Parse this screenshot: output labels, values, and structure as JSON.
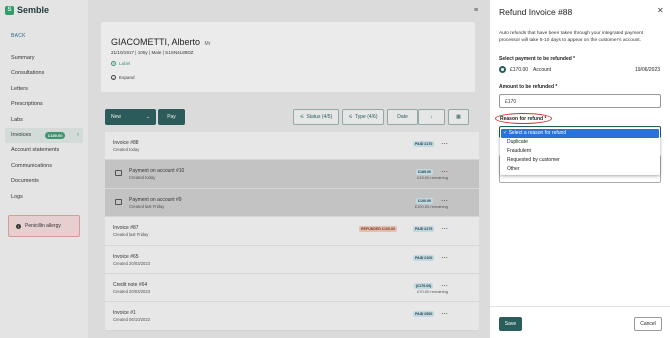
{
  "app": {
    "name": "Semble"
  },
  "sidebar": {
    "back": "BACK",
    "items": [
      {
        "label": "Summary"
      },
      {
        "label": "Consultations"
      },
      {
        "label": "Letters"
      },
      {
        "label": "Prescriptions"
      },
      {
        "label": "Labs"
      },
      {
        "label": "Invoices",
        "badge": "£189.00",
        "active": true
      },
      {
        "label": "Account statements"
      },
      {
        "label": "Communications"
      },
      {
        "label": "Documents"
      },
      {
        "label": "Logs"
      }
    ],
    "allergy": "Penicillin allergy"
  },
  "patient": {
    "name": "GIACOMETTI, Alberto",
    "title": "Mr",
    "meta": "21/10/1917  |  105y  |  Male  |  S1SN4L89DZ",
    "label_link": "Label",
    "expand": "Expand"
  },
  "toolbar": {
    "new": "New",
    "pay": "Pay",
    "status": "Status (4/5)",
    "type": "Type (4/6)",
    "date": "Date",
    "sort_icon": "arrow-down-icon",
    "view_icon": "grid-icon"
  },
  "invoices": [
    {
      "title": "Invoice #88",
      "sub": "Created today",
      "pill": "PAID £170",
      "refund": "",
      "remaining": "",
      "sub_row": false
    },
    {
      "title": "Payment on account #10",
      "sub": "Created today",
      "pill": "£189.00",
      "refund": "",
      "remaining": "£19.00 remaining",
      "sub_row": true
    },
    {
      "title": "Payment on account #9",
      "sub": "Created last Friday",
      "pill": "£100.00",
      "refund": "",
      "remaining": "£100.00 remaining",
      "sub_row": true
    },
    {
      "title": "Invoice #87",
      "sub": "Created last Friday",
      "pill": "PAID £279",
      "refund": "REFUNDED £100.00",
      "remaining": "",
      "sub_row": false
    },
    {
      "title": "Invoice #65",
      "sub": "Created 20/03/2023",
      "pill": "PAID £100",
      "refund": "",
      "remaining": "",
      "sub_row": false
    },
    {
      "title": "Credit note #64",
      "sub": "Created 20/03/2023",
      "pill": "(£170.00)",
      "refund": "",
      "remaining": "£70.00 remaining",
      "sub_row": false
    },
    {
      "title": "Invoice #1",
      "sub": "Created 06/10/2022",
      "pill": "PAID £500",
      "refund": "",
      "remaining": "",
      "sub_row": false
    }
  ],
  "drawer": {
    "title": "Refund Invoice #88",
    "info": "Auto refunds that have been taken through your integrated payment processor will take 5-10 days to appear on the customer's account.",
    "payment_label": "Select payment to be refunded *",
    "payment_amount": "£170.00",
    "payment_account": "Account",
    "payment_date": "19/06/2023",
    "amount_label": "Amount to be refunded *",
    "amount_value": "£170",
    "reason_label": "Reason for refund *",
    "reason_options": [
      {
        "label": "✓ Select a reason for refund",
        "selected": true
      },
      {
        "label": "Duplicate",
        "selected": false
      },
      {
        "label": "Fraudulent",
        "selected": false
      },
      {
        "label": "Requested by customer",
        "selected": false
      },
      {
        "label": "Other",
        "selected": false
      }
    ],
    "save": "Save",
    "cancel": "Cancel"
  },
  "colors": {
    "primary": "#2a5e5d",
    "accent": "#3f9b72",
    "highlight": "#d33333",
    "dropdown_selected": "#2b72d8"
  }
}
